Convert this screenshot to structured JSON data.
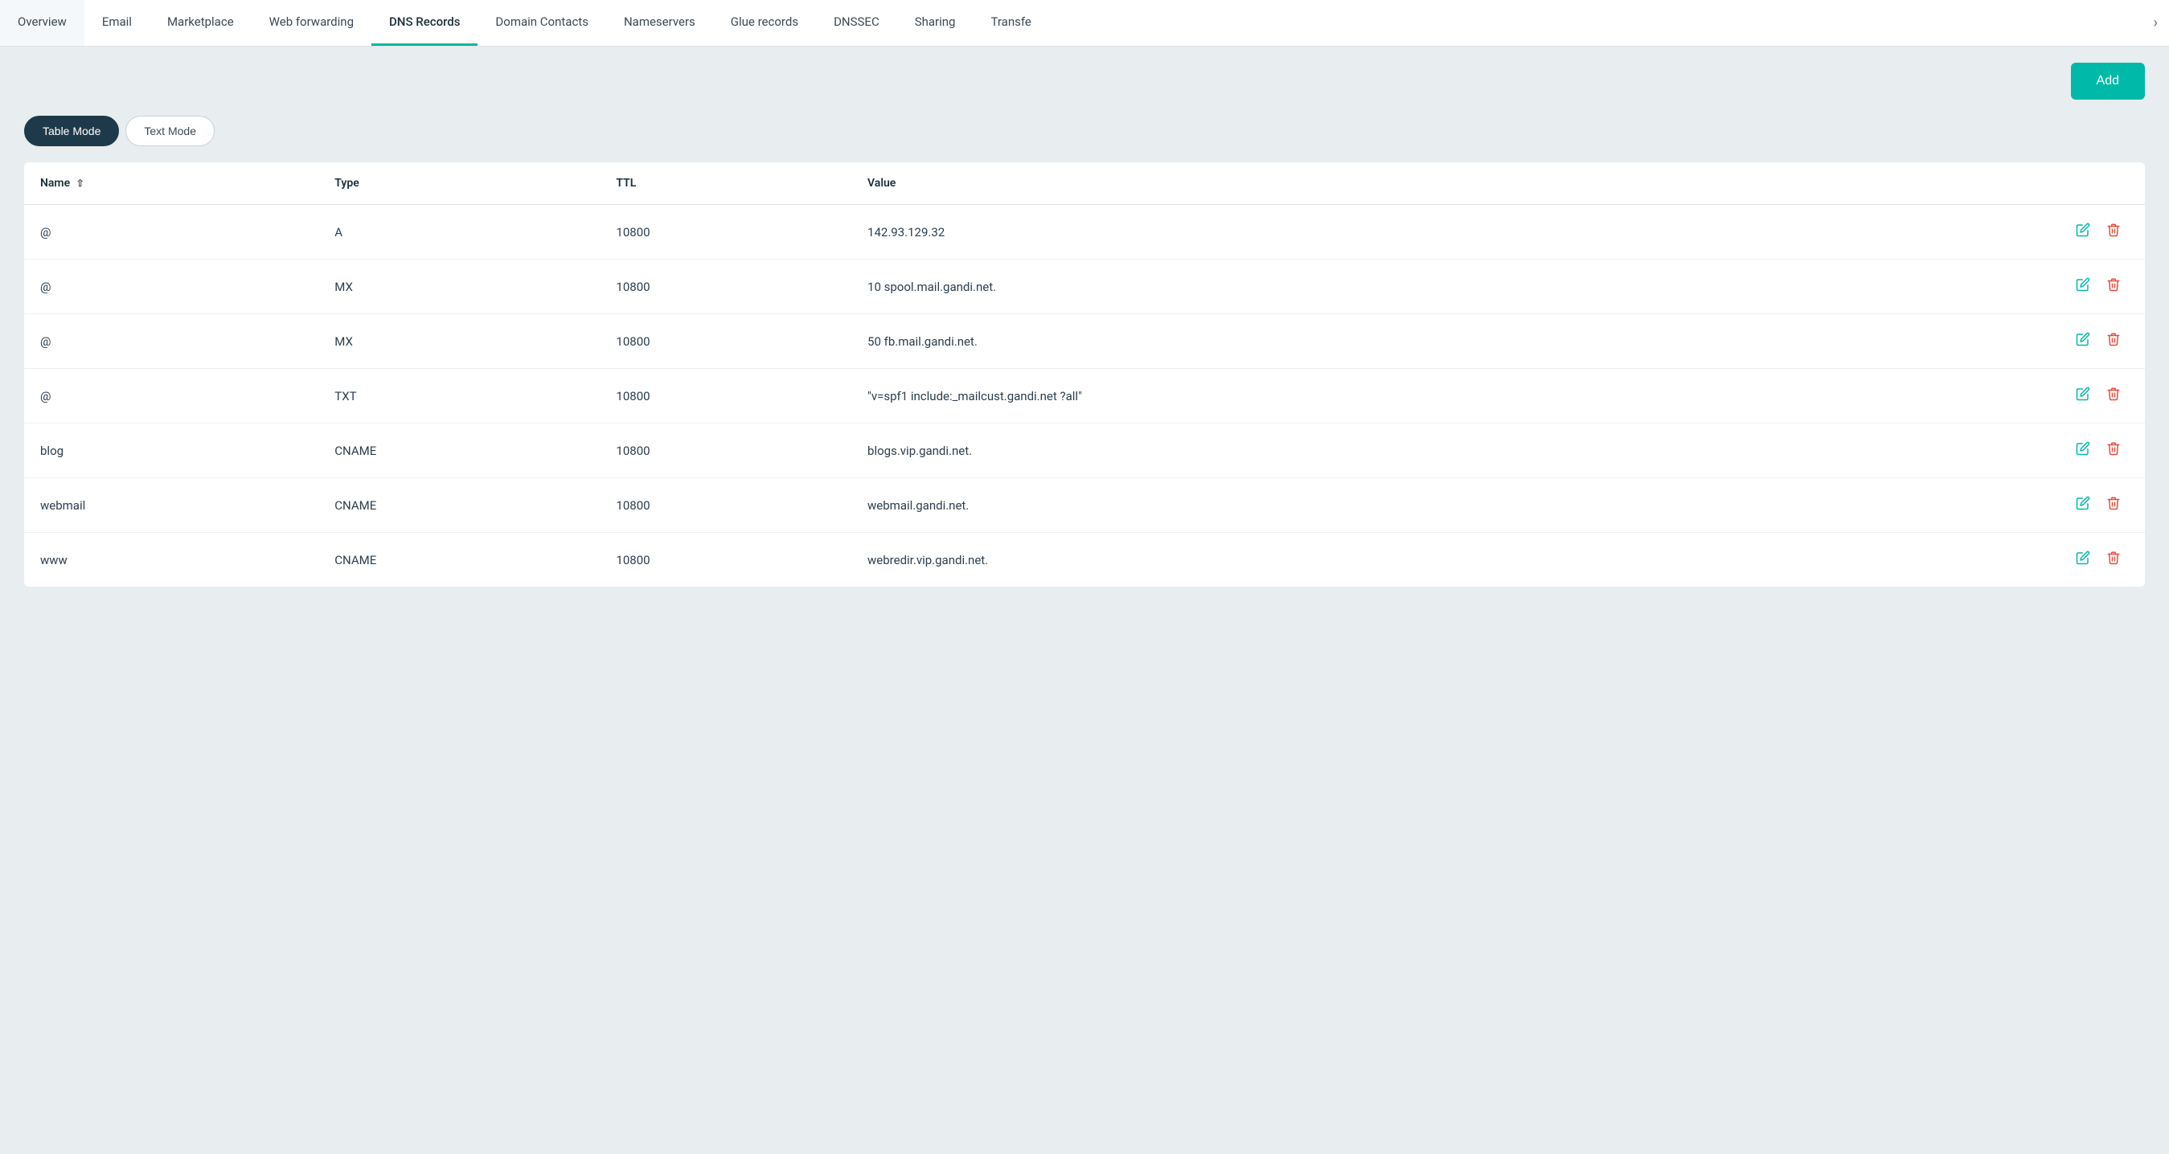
{
  "tabs": [
    {
      "id": "overview",
      "label": "Overview",
      "active": false
    },
    {
      "id": "email",
      "label": "Email",
      "active": false
    },
    {
      "id": "marketplace",
      "label": "Marketplace",
      "active": false
    },
    {
      "id": "web-forwarding",
      "label": "Web forwarding",
      "active": false
    },
    {
      "id": "dns-records",
      "label": "DNS Records",
      "active": true
    },
    {
      "id": "domain-contacts",
      "label": "Domain Contacts",
      "active": false
    },
    {
      "id": "nameservers",
      "label": "Nameservers",
      "active": false
    },
    {
      "id": "glue-records",
      "label": "Glue records",
      "active": false
    },
    {
      "id": "dnssec",
      "label": "DNSSEC",
      "active": false
    },
    {
      "id": "sharing",
      "label": "Sharing",
      "active": false
    },
    {
      "id": "transfer",
      "label": "Transfe",
      "active": false
    }
  ],
  "toolbar": {
    "add_label": "Add"
  },
  "modes": {
    "table_label": "Table Mode",
    "text_label": "Text Mode"
  },
  "table": {
    "columns": [
      {
        "id": "name",
        "label": "Name",
        "sortable": true
      },
      {
        "id": "type",
        "label": "Type",
        "sortable": false
      },
      {
        "id": "ttl",
        "label": "TTL",
        "sortable": false
      },
      {
        "id": "value",
        "label": "Value",
        "sortable": false
      }
    ],
    "rows": [
      {
        "name": "@",
        "type": "A",
        "ttl": "10800",
        "value": "142.93.129.32"
      },
      {
        "name": "@",
        "type": "MX",
        "ttl": "10800",
        "value": "10 spool.mail.gandi.net."
      },
      {
        "name": "@",
        "type": "MX",
        "ttl": "10800",
        "value": "50 fb.mail.gandi.net."
      },
      {
        "name": "@",
        "type": "TXT",
        "ttl": "10800",
        "value": "\"v=spf1 include:_mailcust.gandi.net ?all\""
      },
      {
        "name": "blog",
        "type": "CNAME",
        "ttl": "10800",
        "value": "blogs.vip.gandi.net."
      },
      {
        "name": "webmail",
        "type": "CNAME",
        "ttl": "10800",
        "value": "webmail.gandi.net."
      },
      {
        "name": "www",
        "type": "CNAME",
        "ttl": "10800",
        "value": "webredir.vip.gandi.net."
      }
    ]
  },
  "colors": {
    "active_tab_underline": "#00b9a8",
    "add_button": "#00b9a8",
    "active_mode": "#1e3a4a",
    "edit_icon": "#00b9a8",
    "delete_icon": "#e74c3c"
  }
}
